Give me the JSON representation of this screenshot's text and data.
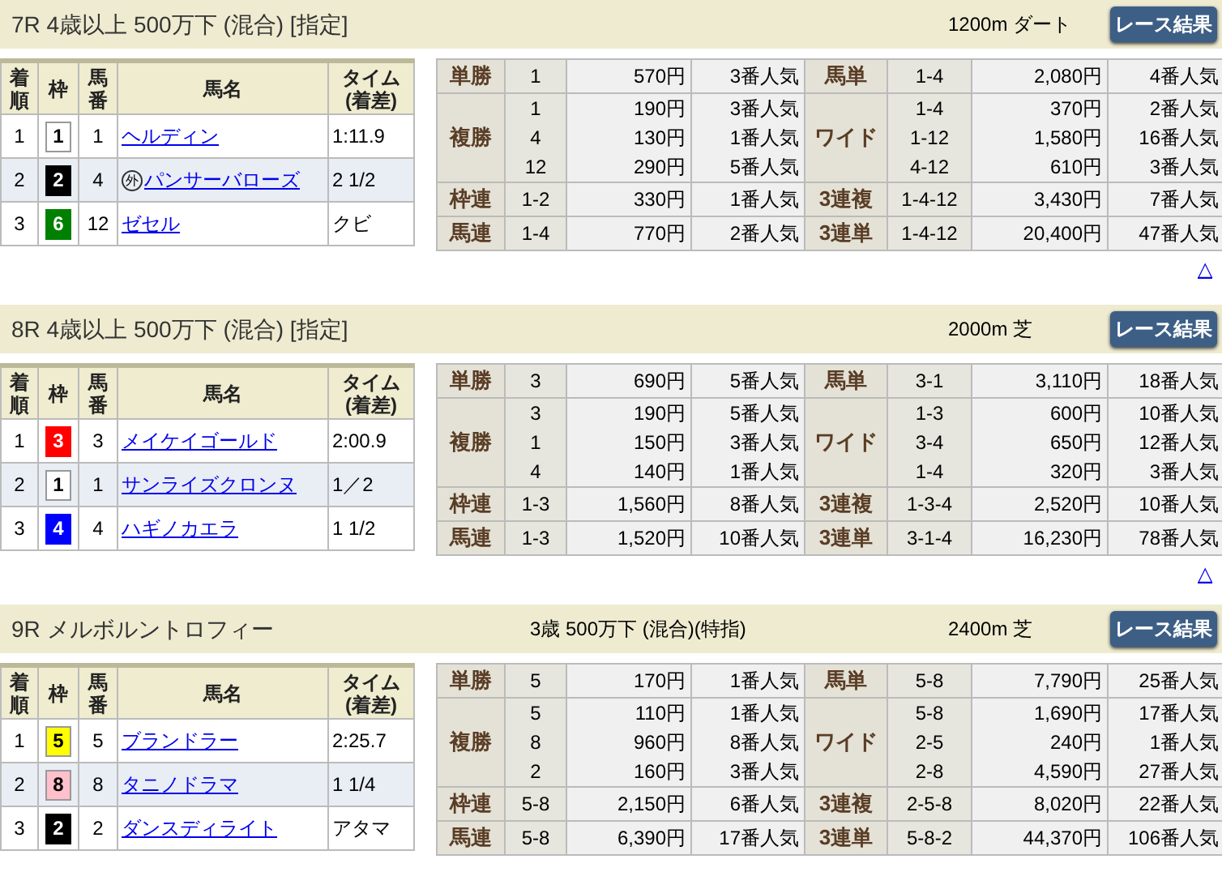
{
  "races": [
    {
      "title": "7R 4歳以上 500万下 (混合) [指定]",
      "course": "1200m ダート",
      "button": "レース結果",
      "result_headers": [
        "着順",
        "枠",
        "馬番",
        "馬名",
        "タイム (着差)"
      ],
      "results": [
        {
          "rank": "1",
          "waku": "1",
          "color": "#ffffff",
          "number": "1",
          "horse": "ヘルディン",
          "time": "1:11.9"
        },
        {
          "rank": "2",
          "waku": "2",
          "color": "#000000",
          "number": "4",
          "prefix": "外",
          "horse": "パンサーバローズ",
          "time": "2 1/2"
        },
        {
          "rank": "3",
          "waku": "6",
          "color": "#008000",
          "number": "12",
          "horse": "ゼセル",
          "time": "クビ"
        }
      ],
      "payouts": [
        {
          "label": "単勝",
          "entries": [
            {
              "combo": "1",
              "amount": "570円",
              "popularity": "3番人気"
            }
          ],
          "label2": "馬単",
          "entries2": [
            {
              "combo": "1-4",
              "amount": "2,080円",
              "popularity": "4番人気"
            }
          ]
        },
        {
          "label": "複勝",
          "entries": [
            {
              "combo": "1",
              "amount": "190円",
              "popularity": "3番人気"
            },
            {
              "combo": "4",
              "amount": "130円",
              "popularity": "1番人気"
            },
            {
              "combo": "12",
              "amount": "290円",
              "popularity": "5番人気"
            }
          ],
          "label2": "ワイド",
          "entries2": [
            {
              "combo": "1-4",
              "amount": "370円",
              "popularity": "2番人気"
            },
            {
              "combo": "1-12",
              "amount": "1,580円",
              "popularity": "16番人気"
            },
            {
              "combo": "4-12",
              "amount": "610円",
              "popularity": "3番人気"
            }
          ]
        },
        {
          "label": "枠連",
          "entries": [
            {
              "combo": "1-2",
              "amount": "330円",
              "popularity": "1番人気"
            }
          ],
          "label2": "3連複",
          "entries2": [
            {
              "combo": "1-4-12",
              "amount": "3,430円",
              "popularity": "7番人気"
            }
          ]
        },
        {
          "label": "馬連",
          "entries": [
            {
              "combo": "1-4",
              "amount": "770円",
              "popularity": "2番人気"
            }
          ],
          "label2": "3連単",
          "entries2": [
            {
              "combo": "1-4-12",
              "amount": "20,400円",
              "popularity": "47番人気"
            }
          ]
        }
      ],
      "top_link": "△"
    },
    {
      "title": "8R 4歳以上 500万下 (混合) [指定]",
      "course": "2000m 芝",
      "button": "レース結果",
      "result_headers": [
        "着順",
        "枠",
        "馬番",
        "馬名",
        "タイム (着差)"
      ],
      "results": [
        {
          "rank": "1",
          "waku": "3",
          "color": "#ff0000",
          "number": "3",
          "horse": "メイケイゴールド",
          "time": "2:00.9"
        },
        {
          "rank": "2",
          "waku": "1",
          "color": "#ffffff",
          "number": "1",
          "horse": "サンライズクロンヌ",
          "time": "1／2"
        },
        {
          "rank": "3",
          "waku": "4",
          "color": "#0000ff",
          "number": "4",
          "horse": "ハギノカエラ",
          "time": "1 1/2"
        }
      ],
      "payouts": [
        {
          "label": "単勝",
          "entries": [
            {
              "combo": "3",
              "amount": "690円",
              "popularity": "5番人気"
            }
          ],
          "label2": "馬単",
          "entries2": [
            {
              "combo": "3-1",
              "amount": "3,110円",
              "popularity": "18番人気"
            }
          ]
        },
        {
          "label": "複勝",
          "entries": [
            {
              "combo": "3",
              "amount": "190円",
              "popularity": "5番人気"
            },
            {
              "combo": "1",
              "amount": "150円",
              "popularity": "3番人気"
            },
            {
              "combo": "4",
              "amount": "140円",
              "popularity": "1番人気"
            }
          ],
          "label2": "ワイド",
          "entries2": [
            {
              "combo": "1-3",
              "amount": "600円",
              "popularity": "10番人気"
            },
            {
              "combo": "3-4",
              "amount": "650円",
              "popularity": "12番人気"
            },
            {
              "combo": "1-4",
              "amount": "320円",
              "popularity": "3番人気"
            }
          ]
        },
        {
          "label": "枠連",
          "entries": [
            {
              "combo": "1-3",
              "amount": "1,560円",
              "popularity": "8番人気"
            }
          ],
          "label2": "3連複",
          "entries2": [
            {
              "combo": "1-3-4",
              "amount": "2,520円",
              "popularity": "10番人気"
            }
          ]
        },
        {
          "label": "馬連",
          "entries": [
            {
              "combo": "1-3",
              "amount": "1,520円",
              "popularity": "10番人気"
            }
          ],
          "label2": "3連単",
          "entries2": [
            {
              "combo": "3-1-4",
              "amount": "16,230円",
              "popularity": "78番人気"
            }
          ]
        }
      ],
      "top_link": "△"
    },
    {
      "title": "9R メルボルントロフィー",
      "conditions": "3歳 500万下 (混合)(特指)",
      "course": "2400m 芝",
      "button": "レース結果",
      "result_headers": [
        "着順",
        "枠",
        "馬番",
        "馬名",
        "タイム (着差)"
      ],
      "results": [
        {
          "rank": "1",
          "waku": "5",
          "color": "#ffff00",
          "number": "5",
          "horse": "ブランドラー",
          "time": "2:25.7"
        },
        {
          "rank": "2",
          "waku": "8",
          "color": "#ffc0cb",
          "number": "8",
          "horse": "タニノドラマ",
          "time": "1 1/4"
        },
        {
          "rank": "3",
          "waku": "2",
          "color": "#000000",
          "number": "2",
          "horse": "ダンスディライト",
          "time": "アタマ"
        }
      ],
      "payouts": [
        {
          "label": "単勝",
          "entries": [
            {
              "combo": "5",
              "amount": "170円",
              "popularity": "1番人気"
            }
          ],
          "label2": "馬単",
          "entries2": [
            {
              "combo": "5-8",
              "amount": "7,790円",
              "popularity": "25番人気"
            }
          ]
        },
        {
          "label": "複勝",
          "entries": [
            {
              "combo": "5",
              "amount": "110円",
              "popularity": "1番人気"
            },
            {
              "combo": "8",
              "amount": "960円",
              "popularity": "8番人気"
            },
            {
              "combo": "2",
              "amount": "160円",
              "popularity": "3番人気"
            }
          ],
          "label2": "ワイド",
          "entries2": [
            {
              "combo": "5-8",
              "amount": "1,690円",
              "popularity": "17番人気"
            },
            {
              "combo": "2-5",
              "amount": "240円",
              "popularity": "1番人気"
            },
            {
              "combo": "2-8",
              "amount": "4,590円",
              "popularity": "27番人気"
            }
          ]
        },
        {
          "label": "枠連",
          "entries": [
            {
              "combo": "5-8",
              "amount": "2,150円",
              "popularity": "6番人気"
            }
          ],
          "label2": "3連複",
          "entries2": [
            {
              "combo": "2-5-8",
              "amount": "8,020円",
              "popularity": "22番人気"
            }
          ]
        },
        {
          "label": "馬連",
          "entries": [
            {
              "combo": "5-8",
              "amount": "6,390円",
              "popularity": "17番人気"
            }
          ],
          "label2": "3連単",
          "entries2": [
            {
              "combo": "5-8-2",
              "amount": "44,370円",
              "popularity": "106番人気"
            }
          ]
        }
      ]
    }
  ]
}
